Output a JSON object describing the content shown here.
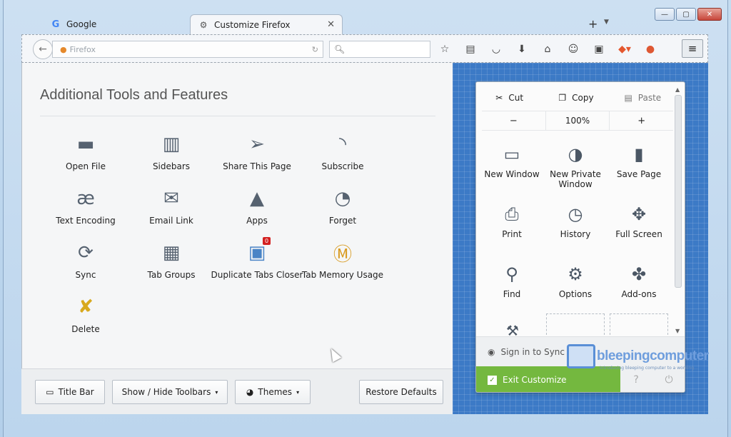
{
  "tabs": [
    {
      "label": "Google",
      "favicon": "google-icon",
      "active": false
    },
    {
      "label": "Customize Firefox",
      "favicon": "gear-icon",
      "active": true
    }
  ],
  "navbar": {
    "url_placeholder": "Firefox"
  },
  "palette": {
    "title": "Additional Tools and Features",
    "tools": [
      {
        "label": "Open File",
        "icon": "folder-icon"
      },
      {
        "label": "Sidebars",
        "icon": "sidebar-icon"
      },
      {
        "label": "Share This Page",
        "icon": "share-icon"
      },
      {
        "label": "Subscribe",
        "icon": "rss-icon"
      },
      {
        "label": "Text Encoding",
        "icon": "text-encoding-icon"
      },
      {
        "label": "Email Link",
        "icon": "mail-icon"
      },
      {
        "label": "Apps",
        "icon": "rocket-icon"
      },
      {
        "label": "Forget",
        "icon": "forget-icon"
      },
      {
        "label": "Sync",
        "icon": "sync-icon"
      },
      {
        "label": "Tab Groups",
        "icon": "tab-groups-icon"
      },
      {
        "label": "Duplicate Tabs Closer",
        "icon": "duplicate-tabs-icon",
        "badge": "0"
      },
      {
        "label": "Tab Memory Usage",
        "icon": "tab-memory-icon"
      },
      {
        "label": "Delete",
        "icon": "broom-icon"
      }
    ]
  },
  "bottombar": {
    "title_bar": "Title Bar",
    "show_hide": "Show / Hide Toolbars",
    "themes": "Themes",
    "restore": "Restore Defaults"
  },
  "menu_panel": {
    "cut": "Cut",
    "copy": "Copy",
    "paste": "Paste",
    "zoom_out": "−",
    "zoom": "100%",
    "zoom_in": "+",
    "items": [
      {
        "label": "New Window",
        "icon": "window-icon"
      },
      {
        "label": "New Private Window",
        "icon": "mask-icon"
      },
      {
        "label": "Save Page",
        "icon": "page-icon"
      },
      {
        "label": "Print",
        "icon": "printer-icon"
      },
      {
        "label": "History",
        "icon": "clock-icon"
      },
      {
        "label": "Full Screen",
        "icon": "fullscreen-icon"
      },
      {
        "label": "Find",
        "icon": "magnifier-icon"
      },
      {
        "label": "Options",
        "icon": "gear-icon"
      },
      {
        "label": "Add-ons",
        "icon": "puzzle-icon"
      }
    ],
    "sign_in": "Sign in to Sync",
    "exit_customize": "Exit Customize"
  },
  "watermark": {
    "text": "bleepingcomputer",
    "tagline": "Introducing bleeping computer to a working…"
  },
  "colors": {
    "accent_green": "#74b83f",
    "panel_blue": "#3c7ac6"
  }
}
